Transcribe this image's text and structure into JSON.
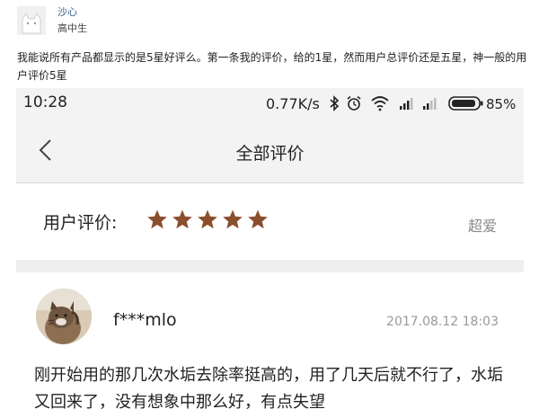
{
  "post": {
    "username": "沙心",
    "role": "高中生",
    "text": "我能说所有产品都显示的是5星好评么。第一条我的评价，给的1星，然而用户总评价还是五星，神一般的用户评价5星"
  },
  "phone": {
    "status_bar": {
      "time": "10:28",
      "speed": "0.77K/s",
      "battery": "85%",
      "icons": [
        "bluetooth-icon",
        "alarm-icon",
        "wifi-icon",
        "signal-icon",
        "signal-icon",
        "battery-icon"
      ]
    },
    "header": {
      "back_icon": "chevron-left-icon",
      "title": "全部评价"
    },
    "rating": {
      "label": "用户评价:",
      "stars": 5,
      "star_color": "#8a4f2c",
      "tag": "超爱"
    },
    "review": {
      "name": "f***mlo",
      "date": "2017.08.12 18:03",
      "text": "刚开始用的那几次水垢去除率挺高的，用了几天后就不行了，水垢又回来了，没有想象中那么好，有点失望"
    }
  }
}
